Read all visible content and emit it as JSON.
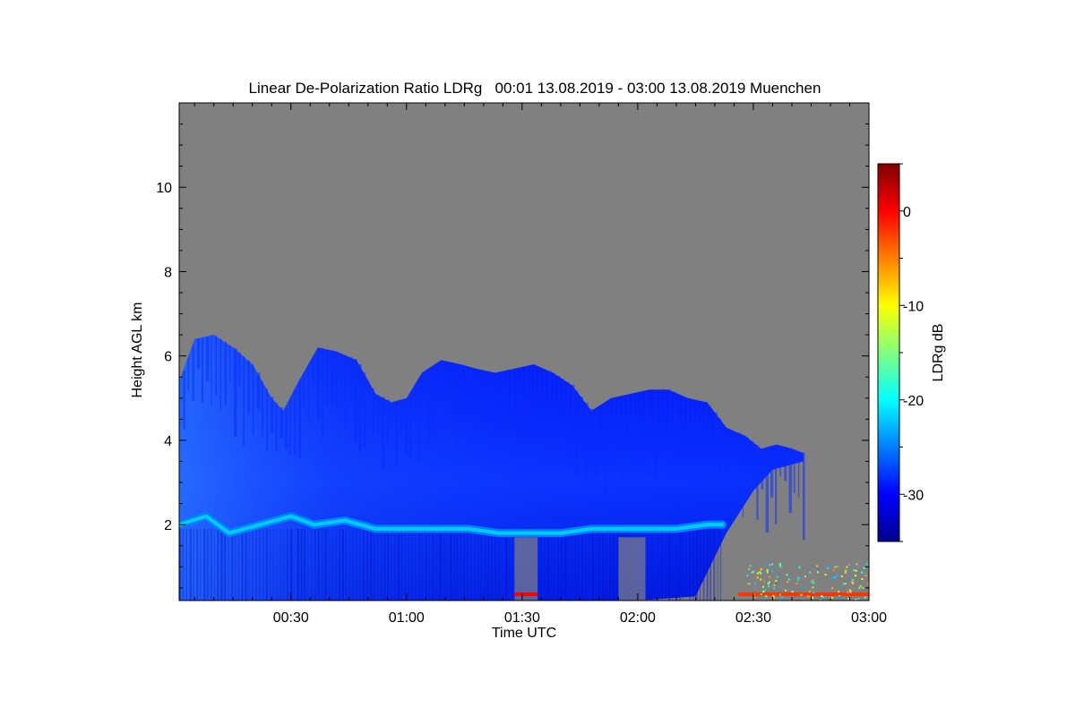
{
  "chart_data": {
    "type": "heatmap",
    "title": "Linear De-Polarization Ratio LDRg   00:01 13.08.2019 - 03:00 13.08.2019 Muenchen",
    "xlabel": "Time UTC",
    "ylabel": "Height AGL km",
    "x_ticks": [
      "00:30",
      "01:00",
      "01:30",
      "02:00",
      "02:30",
      "03:00"
    ],
    "x_tick_values_min": [
      30,
      60,
      90,
      120,
      150,
      180
    ],
    "xlim_min": [
      1,
      180
    ],
    "y_ticks": [
      "2",
      "4",
      "6",
      "8",
      "10"
    ],
    "y_tick_values": [
      2,
      4,
      6,
      8,
      10
    ],
    "ylim": [
      0.2,
      12.0
    ],
    "colorbar": {
      "label": "LDRg dB",
      "ticks": [
        "0",
        "-10",
        "-20",
        "-30"
      ],
      "tick_values": [
        0,
        -10,
        -20,
        -30
      ],
      "range": [
        -35,
        5
      ],
      "colormap": "jet"
    },
    "background_color": "#808080",
    "cloud_top_km": [
      [
        1,
        5.4
      ],
      [
        5,
        6.4
      ],
      [
        10,
        6.5
      ],
      [
        15,
        6.2
      ],
      [
        20,
        5.8
      ],
      [
        25,
        5.0
      ],
      [
        28,
        4.7
      ],
      [
        32,
        5.4
      ],
      [
        37,
        6.2
      ],
      [
        42,
        6.1
      ],
      [
        47,
        5.9
      ],
      [
        52,
        5.1
      ],
      [
        56,
        4.9
      ],
      [
        60,
        5.0
      ],
      [
        64,
        5.6
      ],
      [
        69,
        5.9
      ],
      [
        74,
        5.8
      ],
      [
        78,
        5.7
      ],
      [
        83,
        5.6
      ],
      [
        88,
        5.7
      ],
      [
        93,
        5.8
      ],
      [
        98,
        5.6
      ],
      [
        103,
        5.3
      ],
      [
        108,
        4.7
      ],
      [
        113,
        5.0
      ],
      [
        118,
        5.1
      ],
      [
        123,
        5.2
      ],
      [
        128,
        5.2
      ],
      [
        133,
        5.0
      ],
      [
        138,
        4.9
      ],
      [
        143,
        4.3
      ],
      [
        148,
        4.1
      ],
      [
        152,
        3.8
      ],
      [
        156,
        3.9
      ],
      [
        160,
        3.8
      ],
      [
        163,
        3.7
      ]
    ],
    "cloud_base_km": [
      [
        1,
        0.2
      ],
      [
        120,
        0.2
      ],
      [
        135,
        0.3
      ],
      [
        143,
        1.8
      ],
      [
        150,
        2.8
      ],
      [
        155,
        3.3
      ],
      [
        163,
        3.5
      ]
    ],
    "melting_layer_km": [
      [
        1,
        2.0
      ],
      [
        8,
        2.2
      ],
      [
        14,
        1.8
      ],
      [
        22,
        2.0
      ],
      [
        30,
        2.2
      ],
      [
        36,
        2.0
      ],
      [
        44,
        2.1
      ],
      [
        52,
        1.9
      ],
      [
        60,
        1.9
      ],
      [
        68,
        1.9
      ],
      [
        76,
        1.9
      ],
      [
        84,
        1.8
      ],
      [
        92,
        1.8
      ],
      [
        100,
        1.8
      ],
      [
        108,
        1.9
      ],
      [
        116,
        1.9
      ],
      [
        124,
        1.9
      ],
      [
        130,
        1.9
      ],
      [
        138,
        2.0
      ],
      [
        142,
        2.0
      ]
    ],
    "melting_layer_ldr_db": -22,
    "cloud_ldr_db": -30,
    "ground_clutter": [
      {
        "t_start": 88,
        "t_end": 94,
        "height_km": 0.35,
        "ldr_db": 0
      },
      {
        "t_start": 146,
        "t_end": 180,
        "height_km": 0.35,
        "ldr_db": -2
      }
    ],
    "gaps_below_melting": [
      {
        "t_start": 88,
        "t_end": 94
      },
      {
        "t_start": 115,
        "t_end": 122
      }
    ]
  }
}
